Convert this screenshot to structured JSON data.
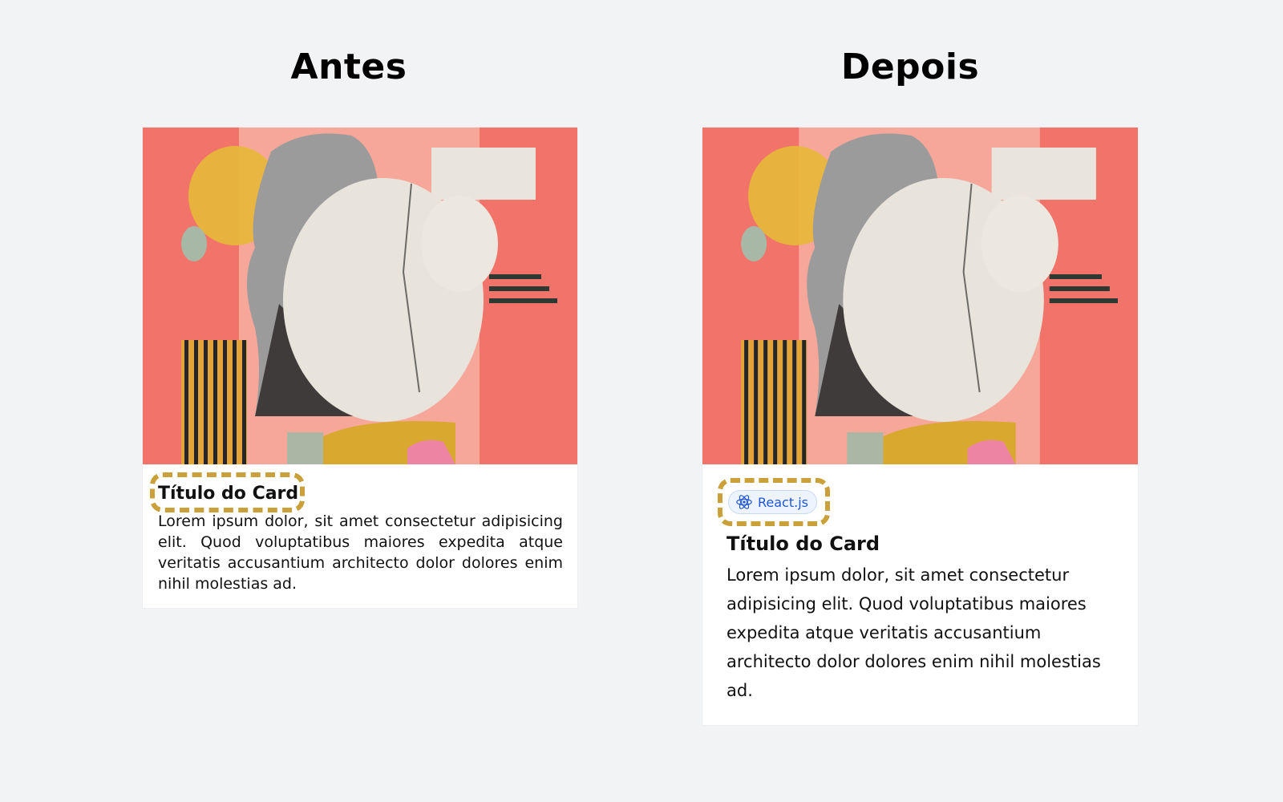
{
  "headings": {
    "before": "Antes",
    "after": "Depois"
  },
  "card_before": {
    "title": "Título do Card",
    "body": "Lorem ipsum dolor, sit amet consectetur adipisicing elit. Quod voluptatibus maiores expedita atque veritatis accusantium architecto dolor dolores enim nihil molestias ad."
  },
  "card_after": {
    "badge": {
      "label": "React.js",
      "icon": "react-icon"
    },
    "title": "Título do Card",
    "body": "Lorem ipsum dolor, sit amet consectetur adipisicing elit. Quod voluptatibus maiores expedita atque veritatis accusantium architecto dolor dolores enim nihil molestias ad."
  },
  "colors": {
    "background": "#f2f3f5",
    "highlight_dash": "#c9a03a",
    "badge_text": "#1e57d6",
    "artwork_pink": "#f2736a"
  }
}
